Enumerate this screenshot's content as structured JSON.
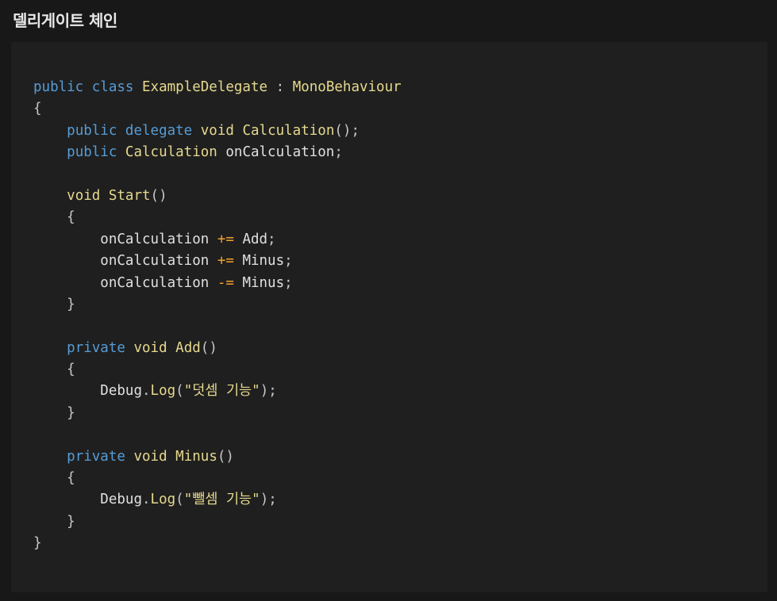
{
  "heading": "델리게이트 체인",
  "code": {
    "language": "csharp",
    "lines": [
      [
        [
          "kw",
          "public"
        ],
        [
          "ws",
          " "
        ],
        [
          "kw",
          "class"
        ],
        [
          "ws",
          " "
        ],
        [
          "type",
          "ExampleDelegate"
        ],
        [
          "ws",
          " "
        ],
        [
          "punct",
          ":"
        ],
        [
          "ws",
          " "
        ],
        [
          "type",
          "MonoBehaviour"
        ]
      ],
      [
        [
          "punct",
          "{"
        ]
      ],
      [
        [
          "ws",
          "    "
        ],
        [
          "kw",
          "public"
        ],
        [
          "ws",
          " "
        ],
        [
          "kw",
          "delegate"
        ],
        [
          "ws",
          " "
        ],
        [
          "type",
          "void"
        ],
        [
          "ws",
          " "
        ],
        [
          "method",
          "Calculation"
        ],
        [
          "punct",
          "();"
        ]
      ],
      [
        [
          "ws",
          "    "
        ],
        [
          "kw",
          "public"
        ],
        [
          "ws",
          " "
        ],
        [
          "type",
          "Calculation"
        ],
        [
          "ws",
          " "
        ],
        [
          "ident",
          "onCalculation"
        ],
        [
          "punct",
          ";"
        ]
      ],
      [],
      [
        [
          "ws",
          "    "
        ],
        [
          "type",
          "void"
        ],
        [
          "ws",
          " "
        ],
        [
          "method",
          "Start"
        ],
        [
          "punct",
          "()"
        ]
      ],
      [
        [
          "ws",
          "    "
        ],
        [
          "punct",
          "{"
        ]
      ],
      [
        [
          "ws",
          "        "
        ],
        [
          "ident",
          "onCalculation"
        ],
        [
          "ws",
          " "
        ],
        [
          "op",
          "+="
        ],
        [
          "ws",
          " "
        ],
        [
          "ident",
          "Add"
        ],
        [
          "punct",
          ";"
        ]
      ],
      [
        [
          "ws",
          "        "
        ],
        [
          "ident",
          "onCalculation"
        ],
        [
          "ws",
          " "
        ],
        [
          "op",
          "+="
        ],
        [
          "ws",
          " "
        ],
        [
          "ident",
          "Minus"
        ],
        [
          "punct",
          ";"
        ]
      ],
      [
        [
          "ws",
          "        "
        ],
        [
          "ident",
          "onCalculation"
        ],
        [
          "ws",
          " "
        ],
        [
          "op",
          "-="
        ],
        [
          "ws",
          " "
        ],
        [
          "ident",
          "Minus"
        ],
        [
          "punct",
          ";"
        ]
      ],
      [
        [
          "ws",
          "    "
        ],
        [
          "punct",
          "}"
        ]
      ],
      [],
      [
        [
          "ws",
          "    "
        ],
        [
          "kw",
          "private"
        ],
        [
          "ws",
          " "
        ],
        [
          "type",
          "void"
        ],
        [
          "ws",
          " "
        ],
        [
          "method",
          "Add"
        ],
        [
          "punct",
          "()"
        ]
      ],
      [
        [
          "ws",
          "    "
        ],
        [
          "punct",
          "{"
        ]
      ],
      [
        [
          "ws",
          "        "
        ],
        [
          "ident",
          "Debug"
        ],
        [
          "punct",
          "."
        ],
        [
          "method",
          "Log"
        ],
        [
          "punct",
          "("
        ],
        [
          "str",
          "\"덧셈 기능\""
        ],
        [
          "punct",
          ");"
        ]
      ],
      [
        [
          "ws",
          "    "
        ],
        [
          "punct",
          "}"
        ]
      ],
      [],
      [
        [
          "ws",
          "    "
        ],
        [
          "kw",
          "private"
        ],
        [
          "ws",
          " "
        ],
        [
          "type",
          "void"
        ],
        [
          "ws",
          " "
        ],
        [
          "method",
          "Minus"
        ],
        [
          "punct",
          "()"
        ]
      ],
      [
        [
          "ws",
          "    "
        ],
        [
          "punct",
          "{"
        ]
      ],
      [
        [
          "ws",
          "        "
        ],
        [
          "ident",
          "Debug"
        ],
        [
          "punct",
          "."
        ],
        [
          "method",
          "Log"
        ],
        [
          "punct",
          "("
        ],
        [
          "str",
          "\"뺄셈 기능\""
        ],
        [
          "punct",
          ");"
        ]
      ],
      [
        [
          "ws",
          "    "
        ],
        [
          "punct",
          "}"
        ]
      ],
      [
        [
          "punct",
          "}"
        ]
      ]
    ]
  },
  "colors": {
    "page_background": "#181818",
    "code_background": "#1f1f1f",
    "keyword": "#569cd6",
    "type_and_method": "#e6d98e",
    "operator": "#f0a330",
    "identifier": "#e0e0e0",
    "punctuation": "#c8c8c8"
  }
}
